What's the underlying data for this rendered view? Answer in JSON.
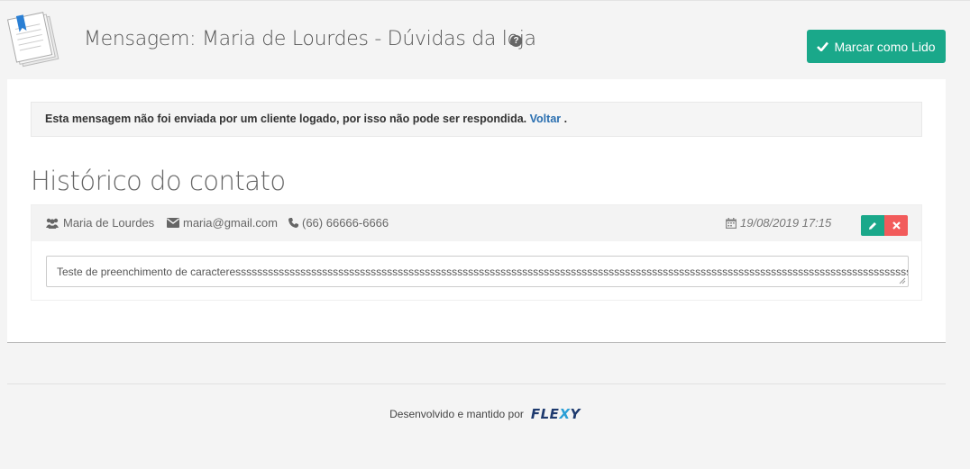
{
  "header": {
    "title": "Mensagem: Maria de Lourdes - Dúvidas da loja",
    "help_icon": "question-circle-icon",
    "mark_read_label": "Marcar como Lido"
  },
  "alert": {
    "text": "Esta mensagem não foi enviada por um cliente logado, por isso não pode ser respondida.",
    "link_text": "Voltar",
    "suffix": "."
  },
  "history": {
    "title": "Histórico do contato",
    "contact": {
      "name": "Maria de Lourdes",
      "email": "maria@gmail.com",
      "phone": "(66) 66666-6666",
      "date": "19/08/2019 17:15",
      "message": "Teste de preenchimento de caracteresssssssssssssssssssssssssssssssssssssssssssssssssssssssssssssssssssssssssssssssssssssssssssssssssssssssssssssssssssssssssssss."
    }
  },
  "footer": {
    "text": "Desenvolvido e mantido por",
    "brand_pre": "FLE",
    "brand_x": "X",
    "brand_post": "Y"
  },
  "colors": {
    "accent": "#1aa88a",
    "danger": "#f25b5b",
    "link": "#2a6fb0"
  }
}
